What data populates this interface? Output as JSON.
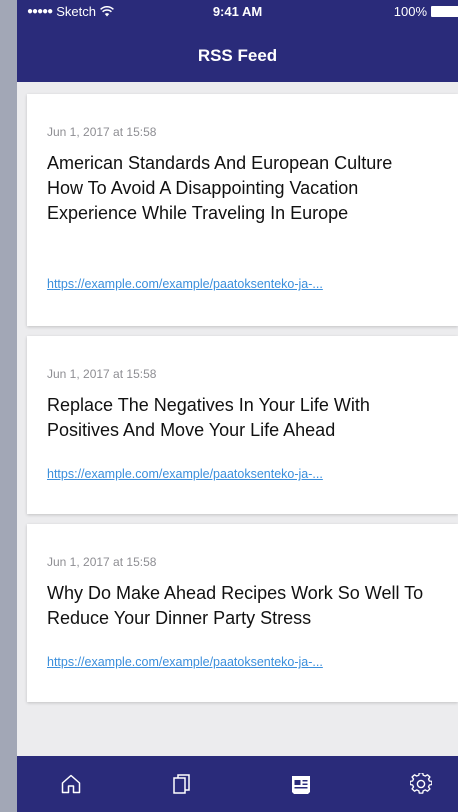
{
  "status_bar": {
    "carrier": "Sketch",
    "time": "9:41 AM",
    "battery": "100%"
  },
  "header": {
    "title": "RSS Feed"
  },
  "feed": [
    {
      "date": "Jun 1, 2017 at 15:58",
      "title": "American Standards And European Culture How To Avoid A Disappointing Vacation Experience While Traveling In Europe",
      "link": "https://example.com/example/paatoksenteko-ja-..."
    },
    {
      "date": "Jun 1, 2017 at 15:58",
      "title": "Replace The Negatives In Your Life With Positives And Move Your Life Ahead",
      "link": "https://example.com/example/paatoksenteko-ja-..."
    },
    {
      "date": "Jun 1, 2017 at 15:58",
      "title": "Why Do Make Ahead Recipes Work So Well To Reduce Your Dinner Party Stress",
      "link": "https://example.com/example/paatoksenteko-ja-..."
    }
  ],
  "tabbar": {
    "items": [
      {
        "icon": "home-icon",
        "active": false
      },
      {
        "icon": "pages-icon",
        "active": false
      },
      {
        "icon": "newspaper-icon",
        "active": true
      },
      {
        "icon": "gear-icon",
        "active": false
      }
    ]
  },
  "colors": {
    "primary": "#2a2b7a",
    "link": "#3b8fdc",
    "background": "#ececee",
    "frame": "#a2a7b6"
  }
}
